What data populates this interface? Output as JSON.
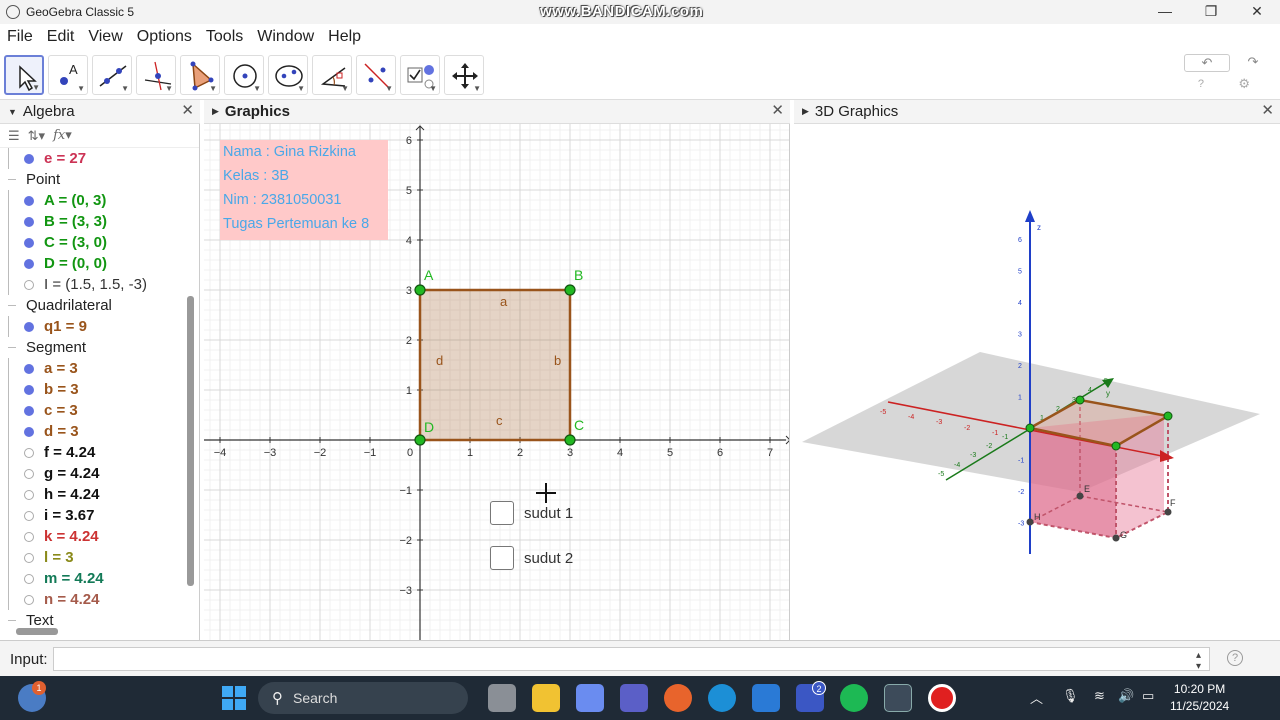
{
  "window": {
    "title": "GeoGebra Classic 5",
    "watermark": "www.BANDICAM.com",
    "controls": [
      "—",
      "❐",
      "✕"
    ]
  },
  "menu": [
    "File",
    "Edit",
    "View",
    "Options",
    "Tools",
    "Window",
    "Help"
  ],
  "toolbar": {
    "tools": [
      "move-tool",
      "point-tool",
      "line-tool",
      "perpendicular-line-tool",
      "polygon-tool",
      "circle-center-point-tool",
      "conic-five-points-tool",
      "angle-tool",
      "reflect-tool",
      "checkbox-tool",
      "move-view-tool"
    ],
    "undo": "↶",
    "redo": "↷",
    "help": "?",
    "settings": "⚙"
  },
  "algebra": {
    "header": "Algebra",
    "close": "✕",
    "rows": [
      {
        "type": "item",
        "text": "e = 27",
        "color": "#cc3355",
        "visible": true
      },
      {
        "type": "cat",
        "text": "Point"
      },
      {
        "type": "item",
        "text": "A = (0, 3)",
        "color": "#129612",
        "visible": true
      },
      {
        "type": "item",
        "text": "B = (3, 3)",
        "color": "#129612",
        "visible": true
      },
      {
        "type": "item",
        "text": "C = (3, 0)",
        "color": "#129612",
        "visible": true
      },
      {
        "type": "item",
        "text": "D = (0, 0)",
        "color": "#129612",
        "visible": true
      },
      {
        "type": "item",
        "text": "I = (1.5, 1.5, -3)",
        "color": "#333333",
        "visible": false,
        "normal": true
      },
      {
        "type": "cat",
        "text": "Quadrilateral"
      },
      {
        "type": "item",
        "text": "q1 = 9",
        "color": "#99541b",
        "visible": true
      },
      {
        "type": "cat",
        "text": "Segment"
      },
      {
        "type": "item",
        "text": "a = 3",
        "color": "#99541b",
        "visible": true
      },
      {
        "type": "item",
        "text": "b = 3",
        "color": "#99541b",
        "visible": true
      },
      {
        "type": "item",
        "text": "c = 3",
        "color": "#99541b",
        "visible": true
      },
      {
        "type": "item",
        "text": "d = 3",
        "color": "#99541b",
        "visible": true
      },
      {
        "type": "item",
        "text": "f = 4.24",
        "color": "#111111",
        "visible": false
      },
      {
        "type": "item",
        "text": "g = 4.24",
        "color": "#111111",
        "visible": false
      },
      {
        "type": "item",
        "text": "h = 4.24",
        "color": "#111111",
        "visible": false
      },
      {
        "type": "item",
        "text": "i = 3.67",
        "color": "#111111",
        "visible": false
      },
      {
        "type": "item",
        "text": "k = 4.24",
        "color": "#cc3333",
        "visible": false
      },
      {
        "type": "item",
        "text": "l = 3",
        "color": "#8a8a1a",
        "visible": false
      },
      {
        "type": "item",
        "text": "m = 4.24",
        "color": "#137a57",
        "visible": false
      },
      {
        "type": "item",
        "text": "n = 4.24",
        "color": "#a55b4b",
        "visible": false
      },
      {
        "type": "cat",
        "text": "Text"
      }
    ]
  },
  "graphics": {
    "header": "Graphics",
    "close": "✕",
    "info": [
      "Nama : Gina Rizkina",
      "Kelas : 3B",
      "Nim : 2381050031",
      "Tugas Pertemuan ke 8"
    ],
    "x_ticks": [
      "−4",
      "−3",
      "−2",
      "−1",
      "0",
      "1",
      "2",
      "3",
      "4",
      "5",
      "6",
      "7"
    ],
    "y_ticks": [
      "6",
      "5",
      "4",
      "3",
      "2",
      "1",
      "−1",
      "−2",
      "−3"
    ],
    "points": [
      "A",
      "B",
      "C",
      "D"
    ],
    "segments": [
      "a",
      "b",
      "c",
      "d"
    ],
    "checkboxes": [
      "sudut 1",
      "sudut 2"
    ]
  },
  "graphics3d": {
    "header": "3D Graphics",
    "close": "✕",
    "z_ticks": [
      "6",
      "5",
      "4",
      "3",
      "2",
      "1",
      "-1",
      "-2",
      "-3"
    ],
    "x_ticks": [
      "-5",
      "-4",
      "-3",
      "-2",
      "-1"
    ],
    "y_ticks": [
      "-5",
      "-4",
      "-3",
      "-2",
      "-1",
      "1",
      "2",
      "3",
      "4",
      "5"
    ],
    "axis_labels": [
      "z",
      "x",
      "y"
    ],
    "point_labels": [
      "E",
      "F",
      "G",
      "H"
    ]
  },
  "input": {
    "label": "Input:",
    "value": "",
    "help": "?"
  },
  "taskbar": {
    "search_placeholder": "Search",
    "time": "10:20 PM",
    "date": "11/25/2024",
    "badge_left": "1",
    "badge_teams": "2"
  }
}
